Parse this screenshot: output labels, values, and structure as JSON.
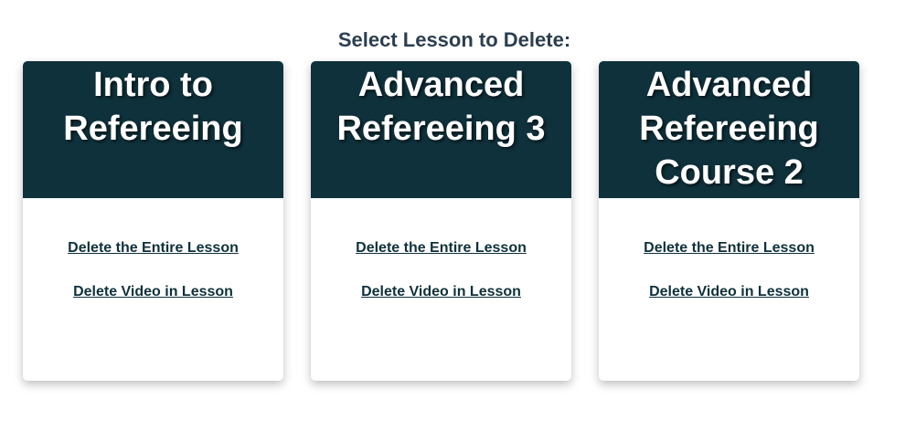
{
  "page": {
    "title": "Select Lesson to Delete:"
  },
  "colors": {
    "card_header_bg": "#0f313b",
    "link_color": "#0f313b",
    "title_color": "#2c3e50"
  },
  "cards": [
    {
      "title": "Intro to Refereeing",
      "delete_lesson_label": "Delete the Entire Lesson",
      "delete_video_label": "Delete Video in Lesson"
    },
    {
      "title": "Advanced Refereeing 3",
      "delete_lesson_label": "Delete the Entire Lesson",
      "delete_video_label": "Delete Video in Lesson"
    },
    {
      "title": "Advanced Refereeing Course 2",
      "delete_lesson_label": "Delete the Entire Lesson",
      "delete_video_label": "Delete Video in Lesson"
    }
  ]
}
